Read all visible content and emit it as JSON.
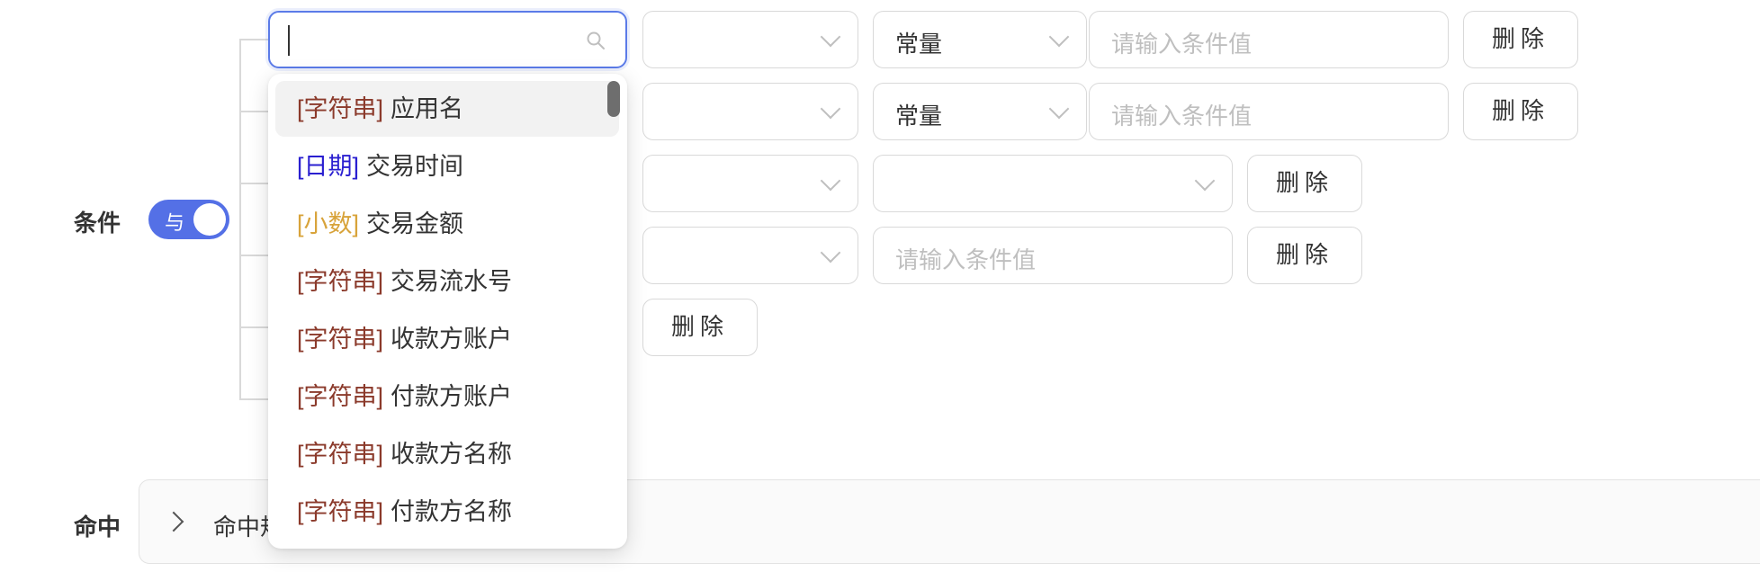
{
  "condition_label": "条件",
  "hit_label": "命中",
  "toggle": {
    "label": "与",
    "on": true
  },
  "search": {
    "value": ""
  },
  "dropdown": {
    "options": [
      {
        "type": "[字符串]",
        "name": "应用名",
        "type_color": "#8b3a2b"
      },
      {
        "type": "[日期]",
        "name": "交易时间",
        "type_color": "#2a1fd0"
      },
      {
        "type": "[小数]",
        "name": "交易金额",
        "type_color": "#d8a33a"
      },
      {
        "type": "[字符串]",
        "name": "交易流水号",
        "type_color": "#8b3a2b"
      },
      {
        "type": "[字符串]",
        "name": "收款方账户",
        "type_color": "#8b3a2b"
      },
      {
        "type": "[字符串]",
        "name": "付款方账户",
        "type_color": "#8b3a2b"
      },
      {
        "type": "[字符串]",
        "name": "收款方名称",
        "type_color": "#8b3a2b"
      },
      {
        "type": "[字符串]",
        "name": "付款方名称",
        "type_color": "#8b3a2b"
      }
    ]
  },
  "rows": [
    {
      "value_type": "常量",
      "value_placeholder": "请输入条件值",
      "delete_label": "删除"
    },
    {
      "value_type": "常量",
      "value_placeholder": "请输入条件值",
      "delete_label": "删除"
    },
    {
      "delete_label": "删除"
    },
    {
      "value_placeholder": "请输入条件值",
      "delete_label": "删除"
    },
    {
      "delete_label": "删除"
    }
  ],
  "hit_panel": {
    "text": "命中规"
  },
  "colors": {
    "accent": "#5470e6",
    "string_tag": "#8b3a2b",
    "date_tag": "#2a1fd0",
    "decimal_tag": "#d8a33a"
  }
}
